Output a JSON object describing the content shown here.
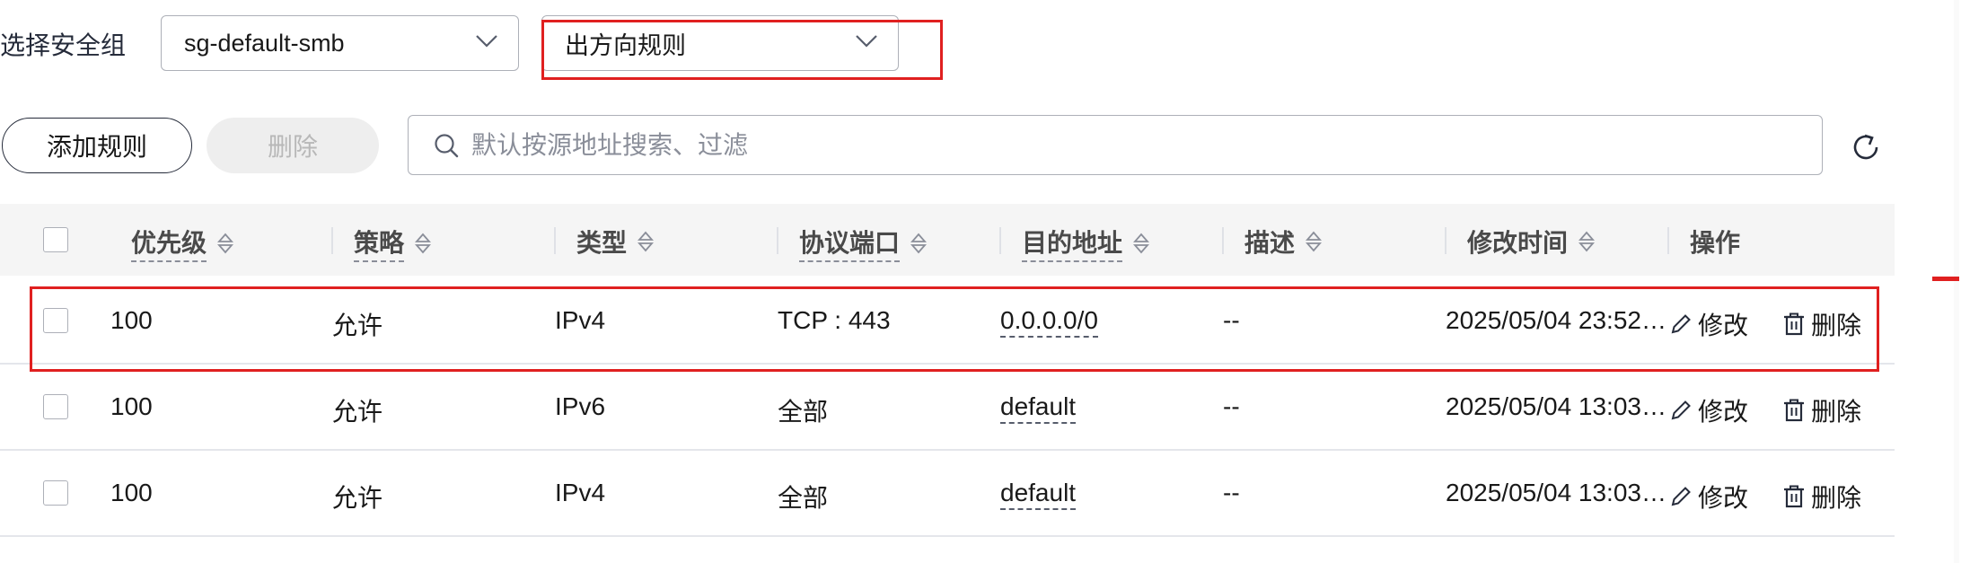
{
  "filter": {
    "label": "选择安全组",
    "security_group": "sg-default-smb",
    "direction": "出方向规则"
  },
  "toolbar": {
    "add_label": "添加规则",
    "delete_label": "删除",
    "search_placeholder": "默认按源地址搜索、过滤"
  },
  "table": {
    "headers": {
      "priority": "优先级",
      "policy": "策略",
      "type": "类型",
      "port": "协议端口",
      "destination": "目的地址",
      "description": "描述",
      "modified": "修改时间",
      "actions": "操作"
    },
    "rows": [
      {
        "priority": "100",
        "policy": "允许",
        "type": "IPv4",
        "port": "TCP : 443",
        "destination": "0.0.0.0/0",
        "description": "--",
        "modified": "2025/05/04 23:52…",
        "edit": "修改",
        "delete": "删除"
      },
      {
        "priority": "100",
        "policy": "允许",
        "type": "IPv6",
        "port": "全部",
        "destination": "default",
        "description": "--",
        "modified": "2025/05/04 13:03…",
        "edit": "修改",
        "delete": "删除"
      },
      {
        "priority": "100",
        "policy": "允许",
        "type": "IPv4",
        "port": "全部",
        "destination": "default",
        "description": "--",
        "modified": "2025/05/04 13:03…",
        "edit": "修改",
        "delete": "删除"
      }
    ]
  },
  "colors": {
    "highlight": "#e02020",
    "border": "#adb0b8",
    "header_bg": "#f5f5f5"
  }
}
